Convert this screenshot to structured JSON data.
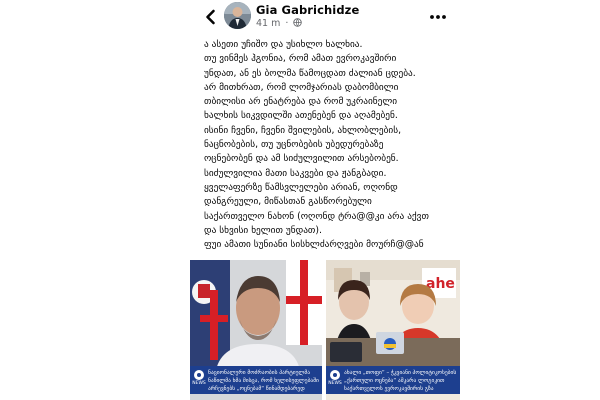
{
  "post": {
    "author": "Gia Gabrichidze",
    "time": "41 m",
    "separator": "·",
    "lines": [
      "ა ასეთი უჩიშო და უსიხლო ხალხია.",
      "თუ ვინმეს ჰგონია, რომ ამათ ევროკავშირი",
      "უნდათ, ან ეს ბოლმა წამოცდათ ძალიან ცდება.",
      "არ მითხრათ, რომ ლომჯარიას დაბომბილი",
      "თბილისი არ ენატრება და რომ უკრაინელი",
      "ხალხის სიკვდილში ათენებენ და აღამებენ.",
      "ისინი ჩვენი, ჩვენი შვილების, ახლობლების,",
      "ნაცნობების, თუ უცნობების უბედურებაზე",
      "ოცნებობენ და ამ სიძულვილით არსებობენ.",
      "სიძულვილია მათი საკვები და ჟანგბადი.",
      "ყველაფერზე წამსვლელები არიან, ოღონდ",
      "დანგრეული, მიწასთან გასწორებული",
      "საქართველო ნახონ (ოღონდ ტრა@@კი არა აქვთ",
      "და სხვისი ხელით უნდათ).",
      "ფუი ამათი სუნიანი სისხლძარღვები მოურჩ@@ან"
    ]
  },
  "media": [
    {
      "news_label": "NEWS",
      "caption_lines": [
        "ნაციონალური მოძრაობის პარტიულმა",
        "ნაწილმა ხმა მისცა, რომ ხელისუფლებაში",
        "არჩევნებს „ოცნებამ“ წინამდებარედ"
      ]
    },
    {
      "news_label": "NEWS",
      "caption_lines": [
        "ახალი „თოფი“ – ჭკვიანი პოლიტიკოსების",
        "„ქართული ოცნება“ აშკარა ლოგიკით",
        "საქართველოს ევროკავშირის გზა"
      ]
    }
  ],
  "colors": {
    "caption_bg": "#1d3f8f",
    "text": "#050505",
    "meta": "#65676b"
  },
  "icons": {
    "back": "back-arrow-icon",
    "more": "more-options-icon",
    "globe": "globe-icon"
  }
}
